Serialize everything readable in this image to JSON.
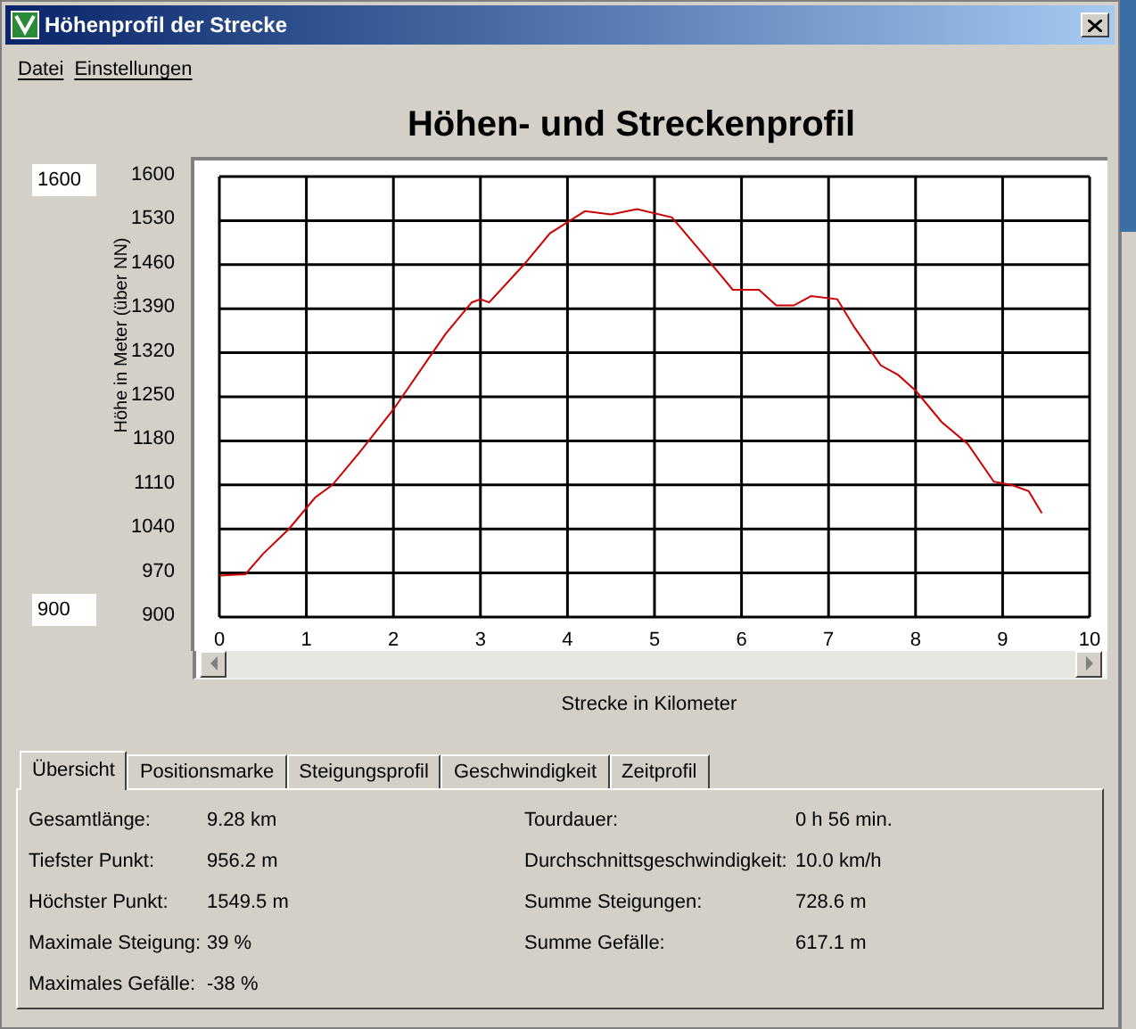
{
  "window": {
    "title": "Höhenprofil der Strecke"
  },
  "menu": [
    "Datei",
    "Einstellungen"
  ],
  "y_max_field": {
    "value": "1600"
  },
  "y_min_field": {
    "value": "900"
  },
  "chart": {
    "chart_data": {
      "type": "line",
      "title": "Höhen- und Streckenprofil",
      "xlabel": "Strecke in Kilometer",
      "ylabel": "Höhe in Meter (über NN)",
      "x": [
        0,
        0.3,
        0.5,
        0.8,
        1.1,
        1.3,
        1.6,
        2.0,
        2.1,
        2.4,
        2.6,
        2.9,
        3.0,
        3.1,
        3.5,
        3.8,
        4.2,
        4.5,
        4.8,
        5.2,
        5.6,
        5.9,
        6.2,
        6.4,
        6.6,
        6.8,
        7.1,
        7.3,
        7.6,
        7.8,
        8.0,
        8.3,
        8.6,
        8.9,
        9.1,
        9.3,
        9.45
      ],
      "grid": true,
      "series": [
        {
          "color": "#cc0000",
          "values": [
            966,
            968,
            1000,
            1040,
            1090,
            1110,
            1160,
            1230,
            1250,
            1310,
            1350,
            1400,
            1405,
            1400,
            1460,
            1510,
            1545,
            1540,
            1548,
            1535,
            1470,
            1420,
            1420,
            1395,
            1395,
            1410,
            1405,
            1360,
            1300,
            1285,
            1260,
            1210,
            1175,
            1115,
            1110,
            1100,
            1065
          ]
        }
      ],
      "xlim": [
        0,
        10
      ],
      "ylim": [
        900,
        1600
      ],
      "xticks": [
        0,
        1,
        2,
        3,
        4,
        5,
        6,
        7,
        8,
        9,
        10
      ],
      "yticks": [
        900,
        970,
        1040,
        1110,
        1180,
        1250,
        1320,
        1390,
        1460,
        1530,
        1600
      ]
    }
  },
  "tabs": [
    {
      "label": "Übersicht",
      "selected": true
    },
    {
      "label": "Positionsmarke",
      "selected": false
    },
    {
      "label": "Steigungsprofil",
      "selected": false
    },
    {
      "label": "Geschwindigkeit",
      "selected": false
    },
    {
      "label": "Zeitprofil",
      "selected": false
    }
  ],
  "stats_left": [
    {
      "label": "Gesamtlänge:",
      "value": "9.28 km"
    },
    {
      "label": "Tiefster Punkt:",
      "value": "956.2 m"
    },
    {
      "label": "Höchster Punkt:",
      "value": "1549.5 m"
    },
    {
      "label": "Maximale Steigung:",
      "value": "39 %"
    },
    {
      "label": "Maximales Gefälle:",
      "value": "-38 %"
    }
  ],
  "stats_right": [
    {
      "label": "Tourdauer:",
      "value": "0 h 56 min."
    },
    {
      "label": "Durchschnittsgeschwindigkeit:",
      "value": "10.0 km/h"
    },
    {
      "label": "Summe Steigungen:",
      "value": "728.6 m"
    },
    {
      "label": "Summe Gefälle:",
      "value": "617.1 m"
    }
  ]
}
